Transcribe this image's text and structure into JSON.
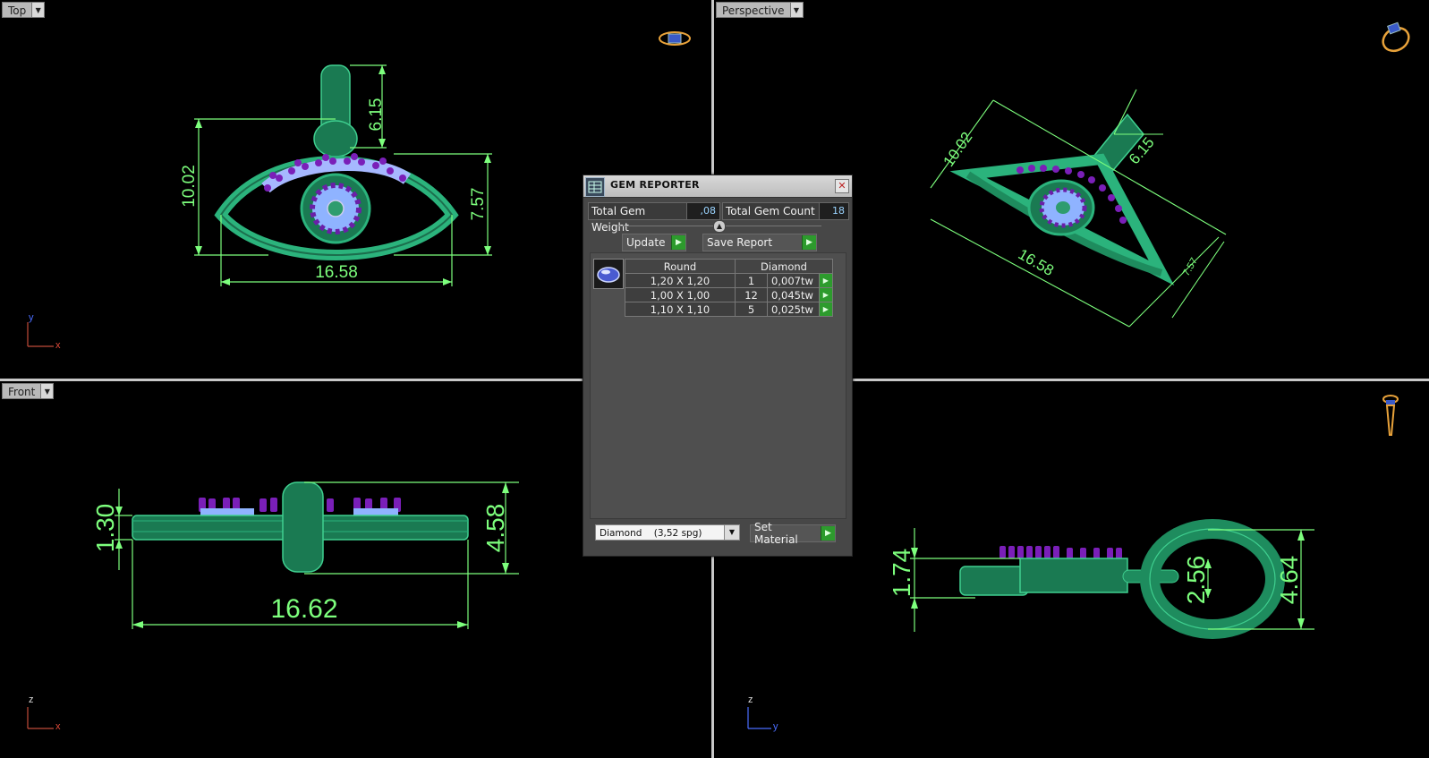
{
  "viewports": {
    "top": {
      "label": "Top"
    },
    "perspective": {
      "label": "Perspective"
    },
    "front": {
      "label": "Front"
    },
    "right": {
      "label": ""
    }
  },
  "dimensions": {
    "top": [
      "6.15",
      "10.02",
      "7.57",
      "16.58"
    ],
    "perspective": [
      "10.02",
      "6.15",
      "16.58",
      "7.57"
    ],
    "front": [
      "1.30",
      "4.58",
      "16.62"
    ],
    "right": [
      "1.74",
      "2.56",
      "4.64"
    ]
  },
  "axes": {
    "top": {
      "v": "y",
      "h": "x"
    },
    "front": {
      "v": "z",
      "h": "x"
    },
    "right": {
      "v": "z",
      "h": "y"
    }
  },
  "gem_reporter": {
    "title": "GEM REPORTER",
    "total_weight_label": "Total Gem Weight",
    "total_weight_value": ",08",
    "total_count_label": "Total Gem Count",
    "total_count_value": "18",
    "update_label": "Update",
    "save_label": "Save Report",
    "table_headers": [
      "Round",
      "Diamond"
    ],
    "rows": [
      {
        "size": "1,20 X 1,20",
        "count": "1",
        "weight": "0,007tw"
      },
      {
        "size": "1,00 X 1,00",
        "count": "12",
        "weight": "0,045tw"
      },
      {
        "size": "1,10 X 1,10",
        "count": "5",
        "weight": "0,025tw"
      }
    ],
    "material_value": "Diamond    (3,52 spg)",
    "set_material_label": "Set Material"
  },
  "colors": {
    "dim": "#7dff7d",
    "metal": "#1e8c5e",
    "gem_purple": "#7a1fb8",
    "gem_blue": "#9fb8ff"
  }
}
